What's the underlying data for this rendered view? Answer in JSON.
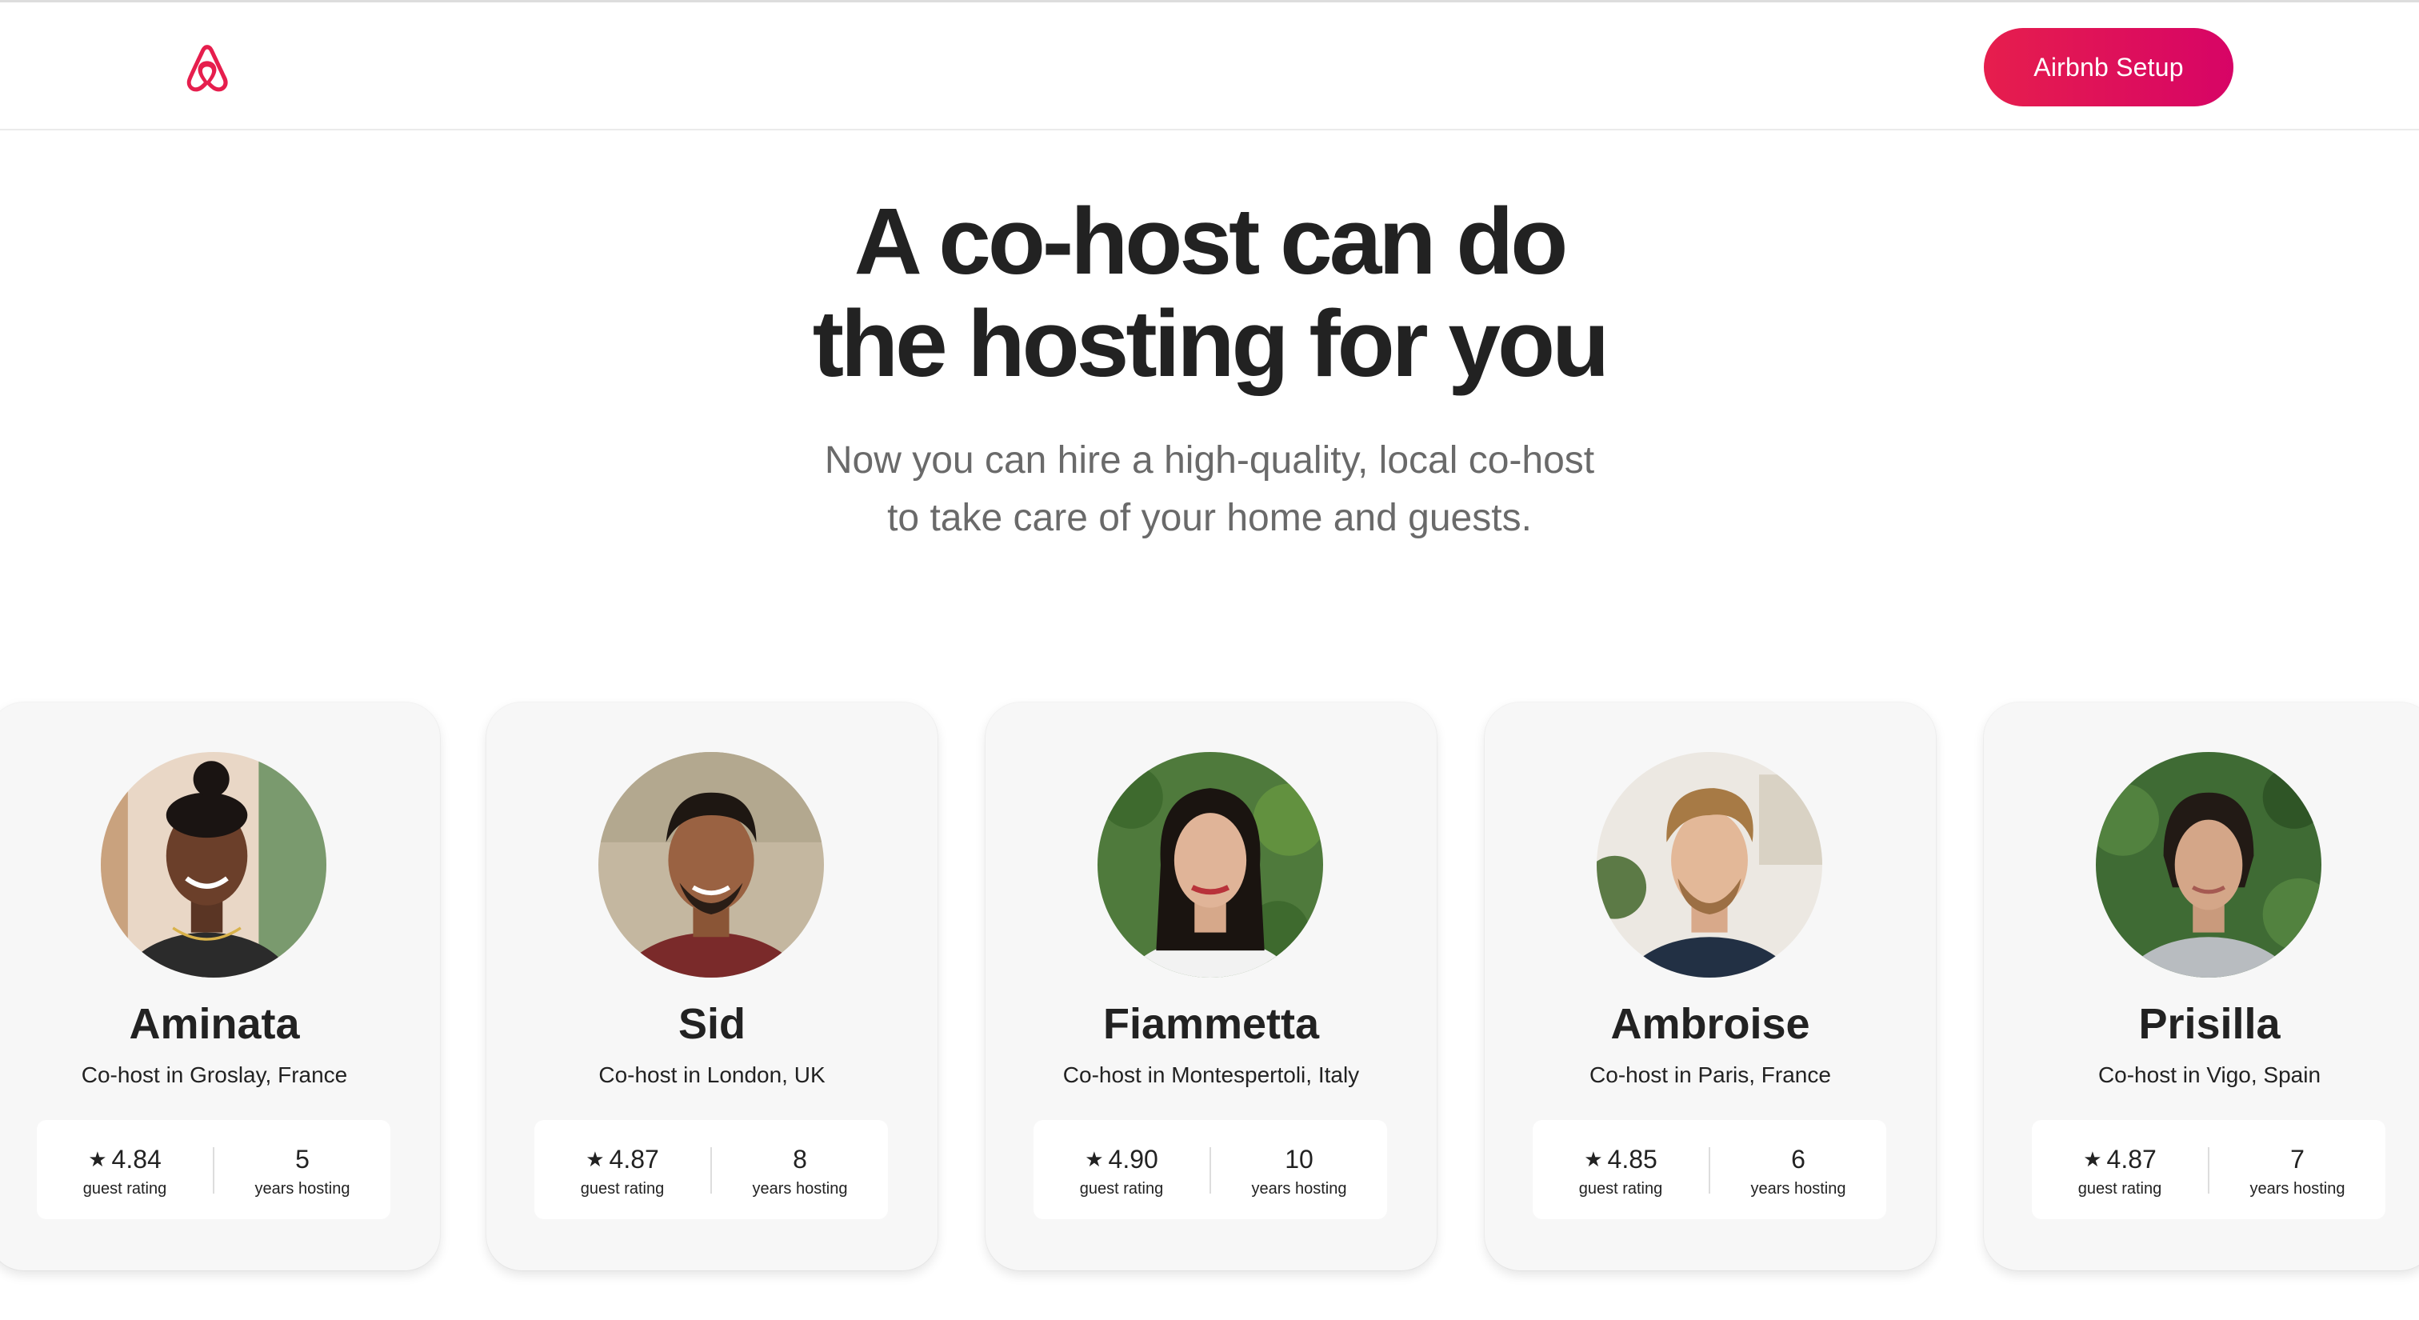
{
  "header": {
    "logo_name": "airbnb-logo",
    "setup_button_label": "Airbnb Setup"
  },
  "hero": {
    "title_line1": "A co-host can do",
    "title_line2": "the hosting for you",
    "subtitle_line1": "Now you can hire a high-quality, local co-host",
    "subtitle_line2": "to take care of your home and guests."
  },
  "colors": {
    "brand": "#e61e4d",
    "brand_end": "#d70466",
    "text": "#222222",
    "muted": "#6a6a6a",
    "card_bg": "#f7f7f7"
  },
  "cohosts": [
    {
      "name": "Aminata",
      "location": "Co-host in Groslay, France",
      "rating": "4.84",
      "rating_label": "guest rating",
      "years": "5",
      "years_label": "years hosting"
    },
    {
      "name": "Sid",
      "location": "Co-host in London, UK",
      "rating": "4.87",
      "rating_label": "guest rating",
      "years": "8",
      "years_label": "years hosting"
    },
    {
      "name": "Fiammetta",
      "location": "Co-host in Montespertoli, Italy",
      "rating": "4.90",
      "rating_label": "guest rating",
      "years": "10",
      "years_label": "years hosting"
    },
    {
      "name": "Ambroise",
      "location": "Co-host in Paris, France",
      "rating": "4.85",
      "rating_label": "guest rating",
      "years": "6",
      "years_label": "years hosting"
    },
    {
      "name": "Prisilla",
      "location": "Co-host in Vigo, Spain",
      "rating": "4.87",
      "rating_label": "guest rating",
      "years": "7",
      "years_label": "years hosting"
    }
  ],
  "icons": {
    "star": "★"
  }
}
